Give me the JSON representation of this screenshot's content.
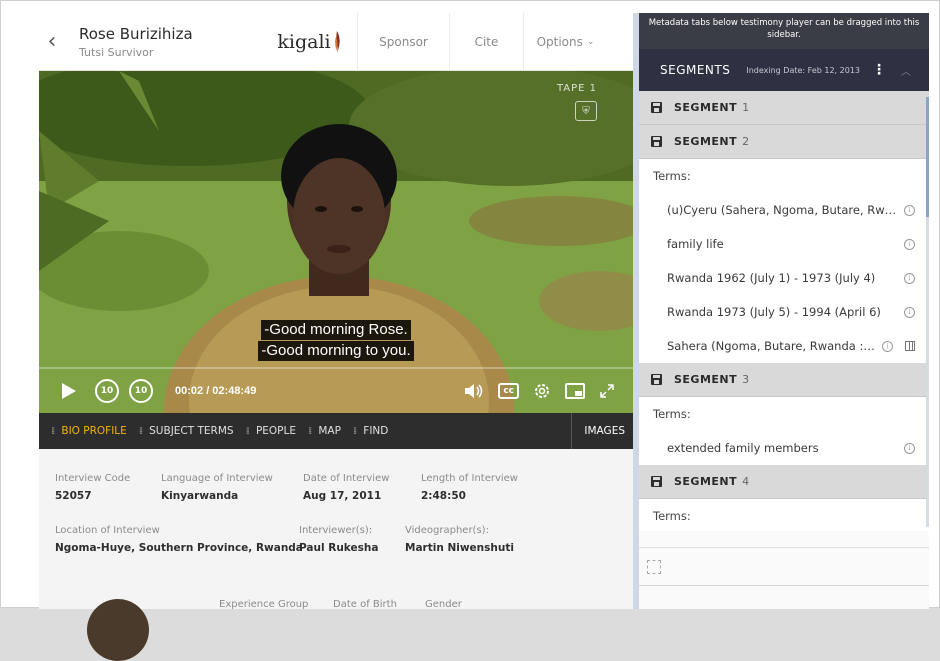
{
  "header": {
    "back_label": "‹",
    "person_name": "Rose Burizihiza",
    "person_role": "Tutsi Survivor",
    "logo_text": "kigali",
    "sponsor_label": "Sponsor",
    "cite_label": "Cite",
    "options_label": "Options"
  },
  "video": {
    "tape_label": "TAPE 1",
    "subtitle_lines": [
      "-Good morning Rose.",
      "-Good morning to you."
    ],
    "time_display": "00:02 / 02:48:49",
    "rewind_label": "10",
    "forward_label": "10",
    "cc_label": "cc",
    "progress_fraction": 0.0002
  },
  "tabs": {
    "items": [
      {
        "label": "BIO PROFILE",
        "active": true
      },
      {
        "label": "SUBJECT TERMS",
        "active": false
      },
      {
        "label": "PEOPLE",
        "active": false
      },
      {
        "label": "MAP",
        "active": false
      },
      {
        "label": "FIND",
        "active": false
      }
    ],
    "images_label": "IMAGES"
  },
  "bio": {
    "interview_code_label": "Interview Code",
    "interview_code": "52057",
    "language_label": "Language of Interview",
    "language": "Kinyarwanda",
    "date_label": "Date of Interview",
    "date": "Aug 17, 2011",
    "length_label": "Length of Interview",
    "length": "2:48:50",
    "location_label": "Location of Interview",
    "location": "Ngoma-Huye, Southern Province, Rwanda",
    "interviewers_label": "Interviewer(s):",
    "interviewers": "Paul Rukesha",
    "videographers_label": "Videographer(s):",
    "videographers": "Martin Niwenshuti",
    "experience_label": "Experience Group",
    "dob_label": "Date of Birth",
    "gender_label": "Gender"
  },
  "sidebar": {
    "tip": "Metadata tabs below testimony player can be dragged into this sidebar.",
    "segments_title": "SEGMENTS",
    "indexing_date": "Indexing Date: Feb 12, 2013",
    "terms_label": "Terms:",
    "segments": [
      {
        "label": "SEGMENT",
        "number": "1"
      },
      {
        "label": "SEGMENT",
        "number": "2"
      },
      {
        "label": "SEGMENT",
        "number": "3"
      },
      {
        "label": "SEGMENT",
        "number": "4"
      }
    ],
    "segment2_terms": [
      "(u)Cyeru (Sahera, Ngoma, Butare, Rwa...",
      "family life",
      "Rwanda 1962 (July 1) - 1973 (July 4)",
      "Rwanda 1973 (July 5) - 1994 (April 6)",
      "Sahera (Ngoma, Butare, Rwanda : ..."
    ],
    "segment3_terms": [
      "extended family members"
    ]
  },
  "colors": {
    "active_tab": "#f5b400",
    "segments_header": "#2d3142",
    "tabs_bar": "#2d2d2d"
  }
}
